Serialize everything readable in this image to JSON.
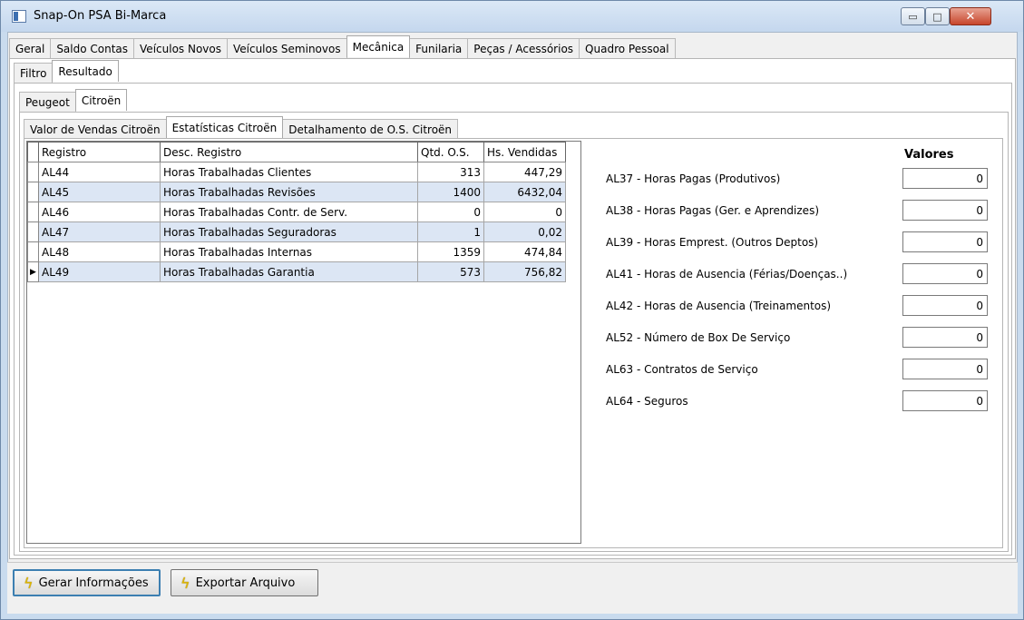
{
  "window": {
    "title": "Snap-On PSA Bi-Marca",
    "min_glyph": "▭",
    "max_glyph": "□",
    "close_glyph": "✕"
  },
  "main_tabs": [
    "Geral",
    "Saldo Contas",
    "Veículos Novos",
    "Veículos Seminovos",
    "Mecânica",
    "Funilaria",
    "Peças / Acessórios",
    "Quadro Pessoal"
  ],
  "main_tabs_active": "Mecânica",
  "view_tabs": [
    "Filtro",
    "Resultado"
  ],
  "view_tabs_active": "Resultado",
  "brand_tabs": [
    "Peugeot",
    "Citroën"
  ],
  "brand_tabs_active": "Citroën",
  "sub_tabs": [
    "Valor de Vendas Citroën",
    "Estatísticas Citroën",
    "Detalhamento de O.S. Citroën"
  ],
  "sub_tabs_active": "Estatísticas Citroën",
  "grid": {
    "headers": [
      "Registro",
      "Desc. Registro",
      "Qtd. O.S.",
      "Hs. Vendidas"
    ],
    "rows": [
      {
        "registro": "AL44",
        "desc": "Horas Trabalhadas Clientes",
        "qtd": "313",
        "hs": "447,29"
      },
      {
        "registro": "AL45",
        "desc": "Horas Trabalhadas Revisões",
        "qtd": "1400",
        "hs": "6432,04"
      },
      {
        "registro": "AL46",
        "desc": "Horas Trabalhadas Contr. de Serv.",
        "qtd": "0",
        "hs": "0"
      },
      {
        "registro": "AL47",
        "desc": "Horas Trabalhadas Seguradoras",
        "qtd": "1",
        "hs": "0,02"
      },
      {
        "registro": "AL48",
        "desc": "Horas Trabalhadas Internas",
        "qtd": "1359",
        "hs": "474,84"
      },
      {
        "registro": "AL49",
        "desc": "Horas Trabalhadas Garantia",
        "qtd": "573",
        "hs": "756,82"
      }
    ],
    "current_row_indicator": "▶"
  },
  "values": {
    "title": "Valores",
    "items": [
      {
        "label": "AL37 - Horas Pagas (Produtivos)",
        "value": "0"
      },
      {
        "label": "AL38 - Horas Pagas (Ger. e Aprendizes)",
        "value": "0"
      },
      {
        "label": "AL39 - Horas Emprest. (Outros Deptos)",
        "value": "0"
      },
      {
        "label": "AL41 - Horas de Ausencia (Férias/Doenças..)",
        "value": "0"
      },
      {
        "label": "AL42 - Horas de Ausencia (Treinamentos)",
        "value": "0"
      },
      {
        "label": "AL52 - Número de Box De Serviço",
        "value": "0"
      },
      {
        "label": "AL63 - Contratos de Serviço",
        "value": "0"
      },
      {
        "label": "AL64 - Seguros",
        "value": "0"
      }
    ]
  },
  "buttons": {
    "gerar": "Gerar Informações",
    "exportar": "Exportar Arquivo",
    "bolt_glyph": "ϟ"
  }
}
